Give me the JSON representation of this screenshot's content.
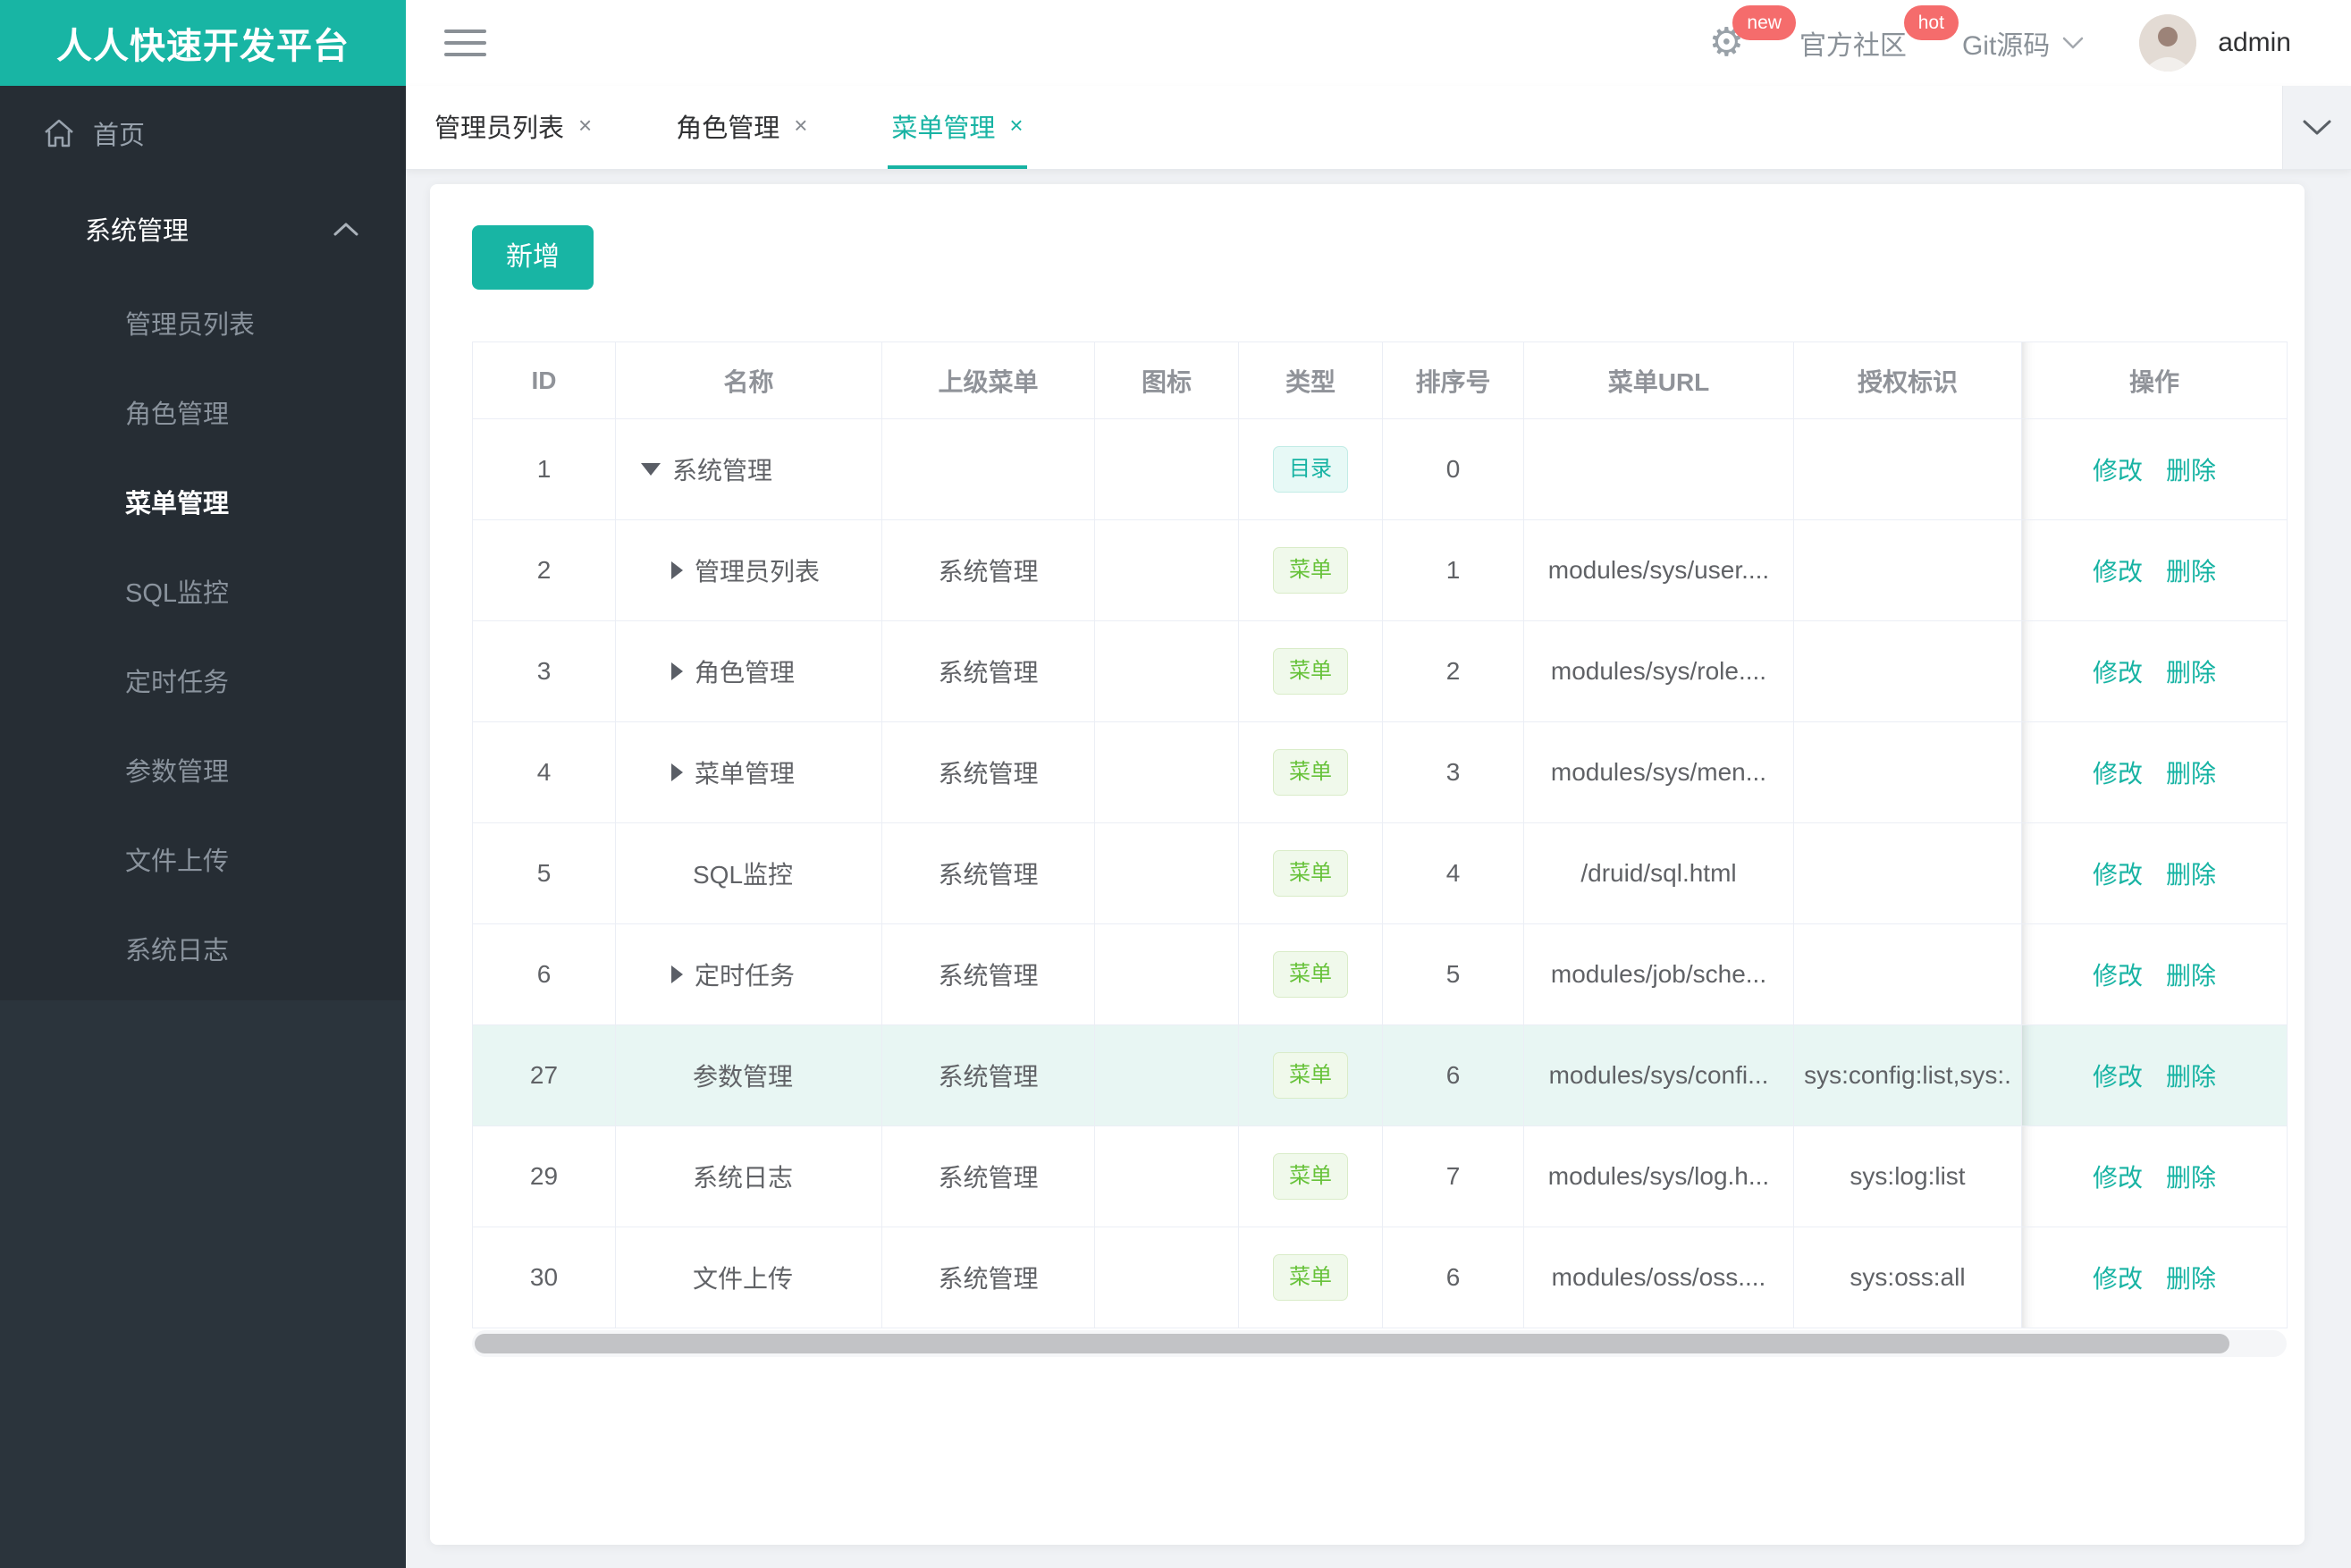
{
  "app": {
    "title": "人人快速开发平台"
  },
  "topbar": {
    "community_label": "官方社区",
    "git_label": "Git源码",
    "user_name": "admin",
    "gear_badge": "new",
    "community_badge": "hot"
  },
  "tabs": [
    {
      "label": "管理员列表",
      "close": "×",
      "active": false
    },
    {
      "label": "角色管理",
      "close": "×",
      "active": false
    },
    {
      "label": "菜单管理",
      "close": "×",
      "active": true
    }
  ],
  "sidebar": {
    "home_label": "首页",
    "group_label": "系统管理",
    "items": [
      "管理员列表",
      "角色管理",
      "菜单管理",
      "SQL监控",
      "定时任务",
      "参数管理",
      "文件上传",
      "系统日志"
    ],
    "active_item": "菜单管理"
  },
  "toolbar": {
    "add_label": "新增"
  },
  "table": {
    "columns": [
      "ID",
      "名称",
      "上级菜单",
      "图标",
      "类型",
      "排序号",
      "菜单URL",
      "授权标识",
      "操作"
    ],
    "actions": {
      "edit": "修改",
      "delete": "删除"
    },
    "rows": [
      {
        "id": "1",
        "name": "系统管理",
        "arrow": "down",
        "level": 0,
        "parent": "",
        "type": "目录",
        "type_kind": "dir",
        "sort": "0",
        "url": "",
        "auth": "",
        "highlight": false
      },
      {
        "id": "2",
        "name": "管理员列表",
        "arrow": "right",
        "level": 1,
        "parent": "系统管理",
        "type": "菜单",
        "type_kind": "menu",
        "sort": "1",
        "url": "modules/sys/user....",
        "auth": "",
        "highlight": false
      },
      {
        "id": "3",
        "name": "角色管理",
        "arrow": "right",
        "level": 1,
        "parent": "系统管理",
        "type": "菜单",
        "type_kind": "menu",
        "sort": "2",
        "url": "modules/sys/role....",
        "auth": "",
        "highlight": false
      },
      {
        "id": "4",
        "name": "菜单管理",
        "arrow": "right",
        "level": 1,
        "parent": "系统管理",
        "type": "菜单",
        "type_kind": "menu",
        "sort": "3",
        "url": "modules/sys/men...",
        "auth": "",
        "highlight": false
      },
      {
        "id": "5",
        "name": "SQL监控",
        "arrow": null,
        "level": 1,
        "parent": "系统管理",
        "type": "菜单",
        "type_kind": "menu",
        "sort": "4",
        "url": "/druid/sql.html",
        "auth": "",
        "highlight": false
      },
      {
        "id": "6",
        "name": "定时任务",
        "arrow": "right",
        "level": 1,
        "parent": "系统管理",
        "type": "菜单",
        "type_kind": "menu",
        "sort": "5",
        "url": "modules/job/sche...",
        "auth": "",
        "highlight": false
      },
      {
        "id": "27",
        "name": "参数管理",
        "arrow": null,
        "level": 1,
        "parent": "系统管理",
        "type": "菜单",
        "type_kind": "menu",
        "sort": "6",
        "url": "modules/sys/confi...",
        "auth": "sys:config:list,sys:.",
        "highlight": true
      },
      {
        "id": "29",
        "name": "系统日志",
        "arrow": null,
        "level": 1,
        "parent": "系统管理",
        "type": "菜单",
        "type_kind": "menu",
        "sort": "7",
        "url": "modules/sys/log.h...",
        "auth": "sys:log:list",
        "highlight": false
      },
      {
        "id": "30",
        "name": "文件上传",
        "arrow": null,
        "level": 1,
        "parent": "系统管理",
        "type": "菜单",
        "type_kind": "menu",
        "sort": "6",
        "url": "modules/oss/oss....",
        "auth": "sys:oss:all",
        "highlight": false
      }
    ]
  },
  "colors": {
    "accent": "#17b3a3",
    "logo_bg": "#18b5a4",
    "sidebar_bg": "#2b343c",
    "sidebar_menu_bg": "#262d34",
    "badge_red": "#f56c6c",
    "row_highlight": "#e8f6f3",
    "tag_dir_text": "#17b3a3",
    "tag_menu_text": "#67c23a",
    "table_border": "#ebeef5",
    "header_text": "#909399",
    "body_text": "#606266",
    "page_bg": "#f0f2f5"
  }
}
